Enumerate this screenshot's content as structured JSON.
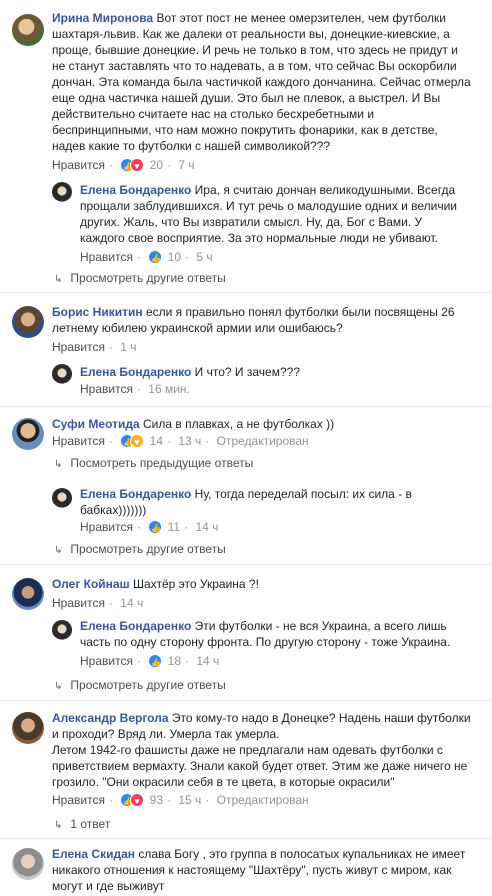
{
  "comments": [
    {
      "author": "Ирина Миронова",
      "text": "Вот этот пост не менее омерзителен, чем футболки шахтаря-львив. Как же далеки от реальности вы, донецкие-киевские, а проще, бывшие донецкие. И речь не только в том, что здесь не придут и не станут заставлять что то надевать, а в том, что сейчас Вы оскорбили дончан. Эта команда была частичкой каждого дончанина. Сейчас отмерла еще одна частичка нашей души. Это был не плевок, а выстрел. И Вы действительно считаете нас на столько бесхребетными и беспринципными, что нам можно покрутить фонарики, как в детстве, надев какие то футболки с нашей символикой???",
      "like_label": "Нравится",
      "reactions_count": "20",
      "time": "7 ч"
    },
    {
      "author": "Елена Бондаренко",
      "text": "Ира, я считаю дончан великодушными. Всегда прощали заблудившихся. И тут речь о малодушие одних и величии других. Жаль, что Вы извратили смысл. Ну, да, Бог с Вами. У каждого свое восприятие. За это нормальные люди не убивают.",
      "like_label": "Нравится",
      "reactions_count": "10",
      "time": "5 ч"
    },
    {
      "more_label": "Просмотреть другие ответы"
    },
    {
      "author": "Борис Никитин",
      "text": "если я правильно понял футболки были посвящены 26 летнему юбилею украинской армии или ошибаюсь?",
      "like_label": "Нравится",
      "time": "1 ч"
    },
    {
      "author": "Елена Бондаренко",
      "text": "И что? И зачем???",
      "like_label": "Нравится",
      "time": "16 мин."
    },
    {
      "author": "Суфи Меотида",
      "text": "Сила в плавках, а не футболках ))",
      "like_label": "Нравится",
      "reactions_count": "14",
      "time": "13 ч",
      "edited": "Отредактирован"
    },
    {
      "more_label": "Посмотреть предыдущие ответы"
    },
    {
      "author": "Елена Бондаренко",
      "text": "Ну, тогда переделай посыл: их сила - в бабках)))))))",
      "like_label": "Нравится",
      "reactions_count": "11",
      "time": "14 ч"
    },
    {
      "more_label": "Просмотреть другие ответы"
    },
    {
      "author": "Олег Койнаш",
      "text": "Шахтёр это Украина ?!",
      "like_label": "Нравится",
      "time": "14 ч"
    },
    {
      "author": "Елена Бондаренко",
      "text": "Эти футболки - не вся Украина, а всего лишь часть по одну сторону фронта. По другую сторону - тоже Украина.",
      "like_label": "Нравится",
      "reactions_count": "18",
      "time": "14 ч"
    },
    {
      "more_label": "Просмотреть другие ответы"
    },
    {
      "author": "Александр Верголa",
      "text": "Это кому-то надо в Донецке? Надень наши футболки и проходи? Вряд ли. Умерла так умерла.",
      "text2": "Летом 1942-го фашисты даже не предлагали нам одевать футболки с приветствием вермахту. Знали какой будет ответ. Этим же даже ничего не грозило. \"Они окрасили себя в те цвета, в которые окрасили\"",
      "like_label": "Нравится",
      "reactions_count": "93",
      "time": "15 ч",
      "edited": "Отредактирован"
    },
    {
      "more_label": "1 ответ"
    },
    {
      "author": "Елена Скидан",
      "text": "слава Богу , это группа в полосатых купальниках не имеет никакого отношения к настоящему \"Шахтёру\", пусть живут с миром, как могут и где выживут"
    }
  ],
  "colors": {
    "author": "#385898",
    "meta": "#90949c",
    "like_reaction": "#2d88ff",
    "love_reaction": "#f33e58"
  }
}
